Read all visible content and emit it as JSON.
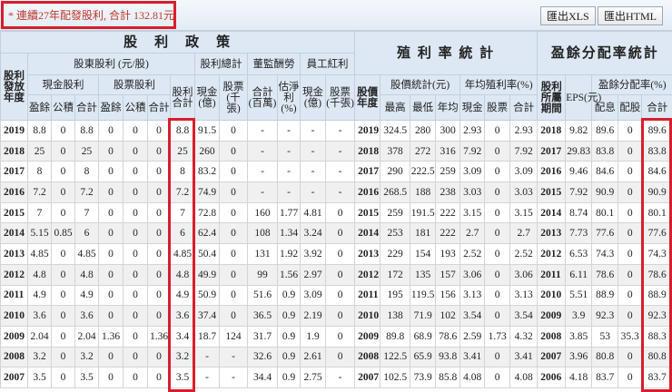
{
  "title": "* 連續27年配發股利, 合計 132.81元",
  "buttons": {
    "xls": "匯出XLS",
    "html": "匯出HTML"
  },
  "headers": {
    "dividend_policy": "股　利　政　策",
    "yield_stats": "殖 利 率 統 計",
    "payout_stats": "盈餘分配率統計",
    "year": "股利發放年度",
    "shareholder_dividend": "股東股利 (元/股)",
    "total_dividend": "股利總計",
    "director_comp": "董監酬勞",
    "employee_bonus": "員工紅利",
    "cash_dividend": "現金股利",
    "stock_dividend": "股票股利",
    "dividend_sum": "股利合計",
    "cash_100m": "現金(億)",
    "stock_k": "股票(千張)",
    "sum_mil": "合計(百萬)",
    "est_net": "估淨利(%)",
    "emp_cash": "現金(億)",
    "emp_stock": "股票(千張)",
    "price_year": "股價年度",
    "price_stats": "股價統計(元)",
    "avg_yield": "年均殖利率(%)",
    "period": "股利所屬期間",
    "eps": "EPS(元)",
    "payout_rate": "盈餘分配率(%)",
    "sub": [
      "盈餘",
      "公積",
      "合計",
      "盈餘",
      "公積",
      "合計",
      "最高",
      "最低",
      "年均",
      "現金",
      "股票",
      "合計",
      "配息",
      "配股",
      "合計"
    ]
  },
  "rows": [
    [
      "2019",
      "8.8",
      "0",
      "8.8",
      "0",
      "0",
      "0",
      "8.8",
      "91.5",
      "0",
      "-",
      "-",
      "-",
      "-",
      "2019",
      "324.5",
      "280",
      "300",
      "2.93",
      "0",
      "2.93",
      "2018",
      "9.82",
      "89.6",
      "0",
      "89.6"
    ],
    [
      "2018",
      "25",
      "0",
      "25",
      "0",
      "0",
      "0",
      "25",
      "260",
      "0",
      "-",
      "-",
      "-",
      "-",
      "2018",
      "378",
      "272",
      "316",
      "7.92",
      "0",
      "7.92",
      "2017",
      "29.83",
      "83.8",
      "0",
      "83.8"
    ],
    [
      "2017",
      "8",
      "0",
      "8",
      "0",
      "0",
      "0",
      "8",
      "83.2",
      "0",
      "-",
      "-",
      "-",
      "-",
      "2017",
      "290",
      "222.5",
      "259",
      "3.09",
      "0",
      "3.09",
      "2016",
      "9.46",
      "84.6",
      "0",
      "84.6"
    ],
    [
      "2016",
      "7.2",
      "0",
      "7.2",
      "0",
      "0",
      "0",
      "7.2",
      "74.9",
      "0",
      "-",
      "-",
      "-",
      "-",
      "2016",
      "268.5",
      "188",
      "238",
      "3.03",
      "0",
      "3.03",
      "2015",
      "7.92",
      "90.9",
      "0",
      "90.9"
    ],
    [
      "2015",
      "7",
      "0",
      "7",
      "0",
      "0",
      "0",
      "7",
      "72.8",
      "0",
      "160",
      "1.77",
      "4.81",
      "0",
      "2015",
      "259",
      "191.5",
      "222",
      "3.15",
      "0",
      "3.15",
      "2014",
      "8.74",
      "80.1",
      "0",
      "80.1"
    ],
    [
      "2014",
      "5.15",
      "0.85",
      "6",
      "0",
      "0",
      "0",
      "6",
      "62.4",
      "0",
      "108",
      "1.34",
      "3.24",
      "0",
      "2014",
      "253",
      "181",
      "222",
      "2.7",
      "0",
      "2.7",
      "2013",
      "7.73",
      "77.6",
      "0",
      "77.6"
    ],
    [
      "2013",
      "4.85",
      "0",
      "4.85",
      "0",
      "0",
      "0",
      "4.85",
      "50.4",
      "0",
      "131",
      "1.92",
      "3.92",
      "0",
      "2013",
      "229",
      "154",
      "193",
      "2.52",
      "0",
      "2.52",
      "2012",
      "6.53",
      "74.3",
      "0",
      "74.3"
    ],
    [
      "2012",
      "4.8",
      "0",
      "4.8",
      "0",
      "0",
      "0",
      "4.8",
      "49.9",
      "0",
      "99",
      "1.56",
      "2.97",
      "0",
      "2012",
      "172",
      "135",
      "157",
      "3.06",
      "0",
      "3.06",
      "2011",
      "6.11",
      "78.6",
      "0",
      "78.6"
    ],
    [
      "2011",
      "4.9",
      "0",
      "4.9",
      "0",
      "0",
      "0",
      "4.9",
      "50.9",
      "0",
      "51.6",
      "0.9",
      "3.09",
      "0",
      "2011",
      "195",
      "119.5",
      "156",
      "3.13",
      "0",
      "3.13",
      "2010",
      "5.51",
      "88.9",
      "0",
      "88.9"
    ],
    [
      "2010",
      "3.6",
      "0",
      "3.6",
      "0",
      "0",
      "0",
      "3.6",
      "37.4",
      "0",
      "36.5",
      "0.9",
      "2.19",
      "0",
      "2010",
      "138",
      "71.9",
      "102",
      "3.54",
      "0",
      "3.54",
      "2009",
      "3.9",
      "92.3",
      "0",
      "92.3"
    ],
    [
      "2009",
      "2.04",
      "0",
      "2.04",
      "1.36",
      "0",
      "1.36",
      "3.4",
      "18.7",
      "124",
      "31.7",
      "0.9",
      "1.9",
      "0",
      "2009",
      "89.8",
      "68.9",
      "78.6",
      "2.59",
      "1.73",
      "4.32",
      "2008",
      "3.85",
      "53",
      "35.3",
      "88.3"
    ],
    [
      "2008",
      "3.2",
      "0",
      "3.2",
      "0",
      "0",
      "0",
      "3.2",
      "-",
      "-",
      "32.6",
      "0.9",
      "2.61",
      "0",
      "2008",
      "122.5",
      "65.9",
      "93.8",
      "3.41",
      "0",
      "3.41",
      "2007",
      "3.96",
      "80.8",
      "0",
      "80.8"
    ],
    [
      "2007",
      "3.5",
      "0",
      "3.5",
      "0",
      "0",
      "0",
      "3.5",
      "-",
      "-",
      "34.4",
      "0.9",
      "2.75",
      "-",
      "2007",
      "102.5",
      "73.9",
      "85.8",
      "4.08",
      "0",
      "4.08",
      "2006",
      "4.18",
      "83.7",
      "0",
      "83.7"
    ]
  ],
  "accent": "#d81e2c"
}
